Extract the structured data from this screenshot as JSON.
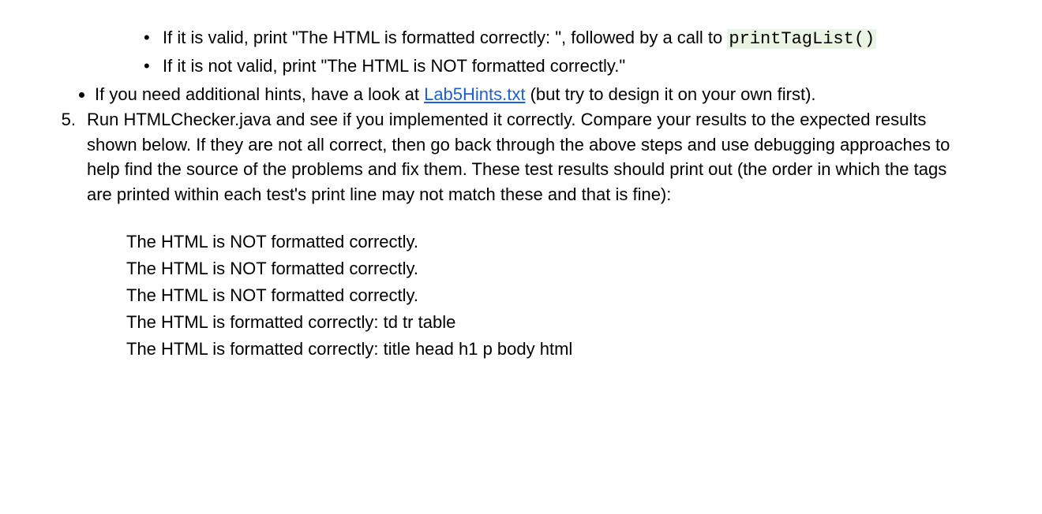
{
  "bullets_inner": [
    {
      "pre": "If it is valid, print \"The HTML is formatted correctly: \", followed by a call to ",
      "code": "printTagList()"
    },
    {
      "pre": "If it is not valid, print \"The HTML is NOT formatted correctly.\""
    }
  ],
  "bullet_outer": {
    "pre": "If you need additional hints, have a look at ",
    "link": "Lab5Hints.txt",
    "post": " (but try to design it on your own first)."
  },
  "step5": {
    "num": "5.",
    "text": "Run HTMLChecker.java and see if you implemented it correctly. Compare your results to the expected results shown below. If they are not all correct, then go back through the above steps and use debugging approaches to help find the source of the problems and fix them. These test results should print out (the order in which the tags are printed within each test's print line may not match these and that is fine):"
  },
  "results": [
    "The HTML is NOT formatted correctly.",
    "The HTML is NOT formatted correctly.",
    "The HTML is NOT formatted correctly.",
    "The HTML is formatted correctly: td tr table",
    "The HTML is formatted correctly: title head h1 p body html"
  ]
}
